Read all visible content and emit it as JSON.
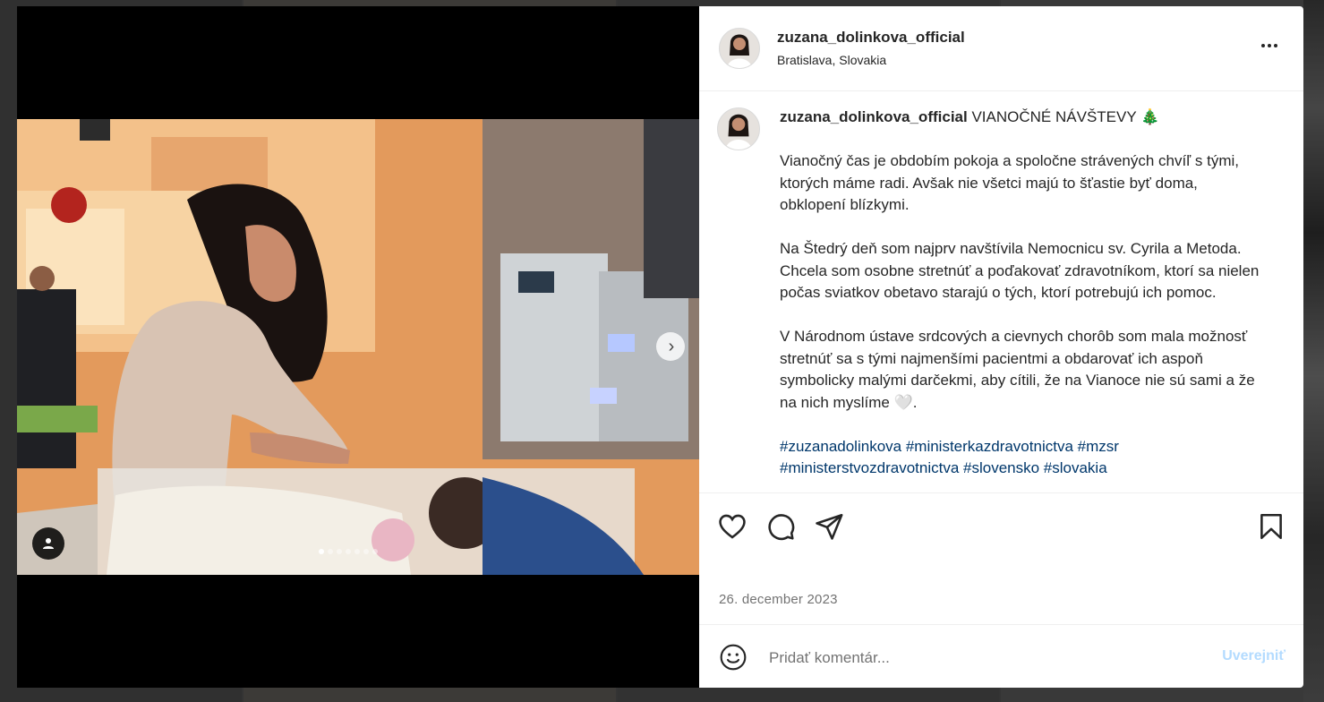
{
  "post": {
    "username": "zuzana_dolinkova_official",
    "location": "Bratislava, Slovakia",
    "caption_title": "VIANOČNÉ NÁVŠTEVY 🎄",
    "paragraphs": [
      "Vianočný čas je obdobím pokoja a spoločne strávených chvíľ s tými, ktorých máme radi. Avšak nie všetci majú to šťastie byť doma, obklopení blízkymi.",
      "Na Štedrý deň som najprv navštívila Nemocnicu sv. Cyrila a Metoda. Chcela som osobne stretnúť a poďakovať zdravotníkom, ktorí sa nielen počas sviatkov obetavo starajú o tých, ktorí potrebujú ich pomoc.",
      "V Národnom ústave srdcových a cievnych chorôb som mala možnosť stretnúť sa s tými najmenšími pacientmi a obdarovať ich aspoň symbolicky malými darčekmi, aby cítili, že na Vianoce nie sú sami a že na nich myslíme 🤍."
    ],
    "hashtags_line1": "#zuzanadolinkova #ministerkazdravotnictva #mzsr",
    "hashtags_line2": "#ministerstvozdravotnictva #slovensko #slovakia",
    "date": "26. december 2023",
    "carousel": {
      "current": 1,
      "total": 7
    }
  },
  "comment": {
    "placeholder": "Pridať komentár...",
    "post_label": "Uverejniť"
  },
  "icons": {
    "like": "heart-icon",
    "comment": "comment-icon",
    "share": "paper-plane-icon",
    "save": "bookmark-icon",
    "more": "more-options-icon",
    "emoji": "emoji-icon",
    "next": "chevron-right-icon",
    "tags": "user-tag-icon"
  },
  "colors": {
    "text": "#262626",
    "secondary": "#737373",
    "hashtag": "#00376b",
    "post_disabled": "#b3dbff"
  }
}
